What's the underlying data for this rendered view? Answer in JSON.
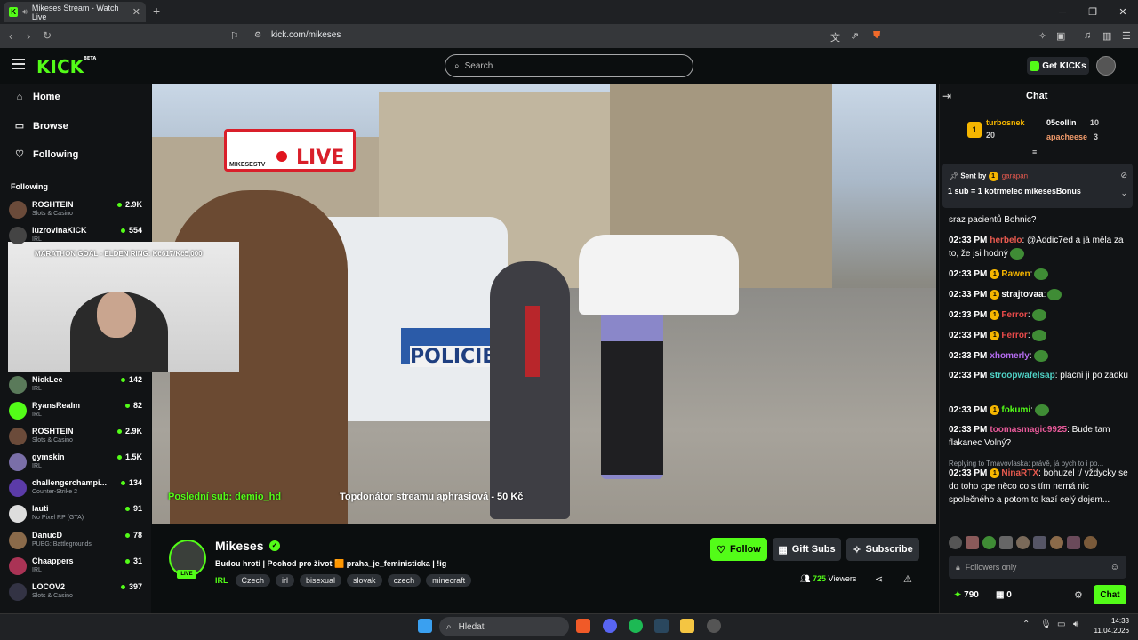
{
  "browser": {
    "tab_title": "Mikeses Stream - Watch Live",
    "url": "kick.com/mikeses",
    "tab_close": "✕",
    "new_tab": "+"
  },
  "header": {
    "logo": "KICK",
    "logo_beta": "BETA",
    "search_placeholder": "Search",
    "get_kicks": "Get KICKs"
  },
  "sidebar": {
    "nav": [
      {
        "label": "Home",
        "icon": "home-icon"
      },
      {
        "label": "Browse",
        "icon": "browse-icon"
      },
      {
        "label": "Following",
        "icon": "heart-icon"
      }
    ],
    "following_heading": "Following",
    "channels": [
      {
        "name": "ROSHTEIN",
        "category": "Slots & Casino",
        "viewers": "2.9K",
        "color": "#6b4b3a"
      },
      {
        "name": "luzrovinaKICK",
        "category": "IRL",
        "viewers": "554",
        "color": "#444"
      },
      {
        "name": "NickLee",
        "category": "IRL",
        "viewers": "142",
        "color": "#5a7a5a"
      },
      {
        "name": "RyansRealm",
        "category": "IRL",
        "viewers": "82",
        "color": "#53fc18"
      },
      {
        "name": "ROSHTEIN",
        "category": "Slots & Casino",
        "viewers": "2.9K",
        "color": "#6b4b3a"
      },
      {
        "name": "gymskin",
        "category": "IRL",
        "viewers": "1.5K",
        "color": "#7a6fa8"
      },
      {
        "name": "challengerchampi...",
        "category": "Counter-Strike 2",
        "viewers": "134",
        "color": "#5b3ba8"
      },
      {
        "name": "lauti",
        "category": "No Pixel RP (GTA)",
        "viewers": "91",
        "color": "#ddd"
      },
      {
        "name": "DanucD",
        "category": "PUBG: Battlegrounds",
        "viewers": "78",
        "color": "#8a6a4a"
      },
      {
        "name": "Chaappers",
        "category": "IRL",
        "viewers": "31",
        "color": "#aa3355"
      },
      {
        "name": "LOCOV2",
        "category": "Slots & Casino",
        "viewers": "397",
        "color": "#334"
      }
    ]
  },
  "video": {
    "marathon_goal": "MARATHON GOAL - ELDEN RING: Kč617/Kč5,000",
    "live_badge": "LIVE",
    "live_badge_brand": "MIKESESTV",
    "last_sub": "Poslední sub: demio_hd",
    "top_donor": "Topdonátor streamu aphrasiová - 50 Kč"
  },
  "channel": {
    "name": "Mikeses",
    "live_chip": "LIVE",
    "title": "Budou hroti | Pochod pro život 🟧 praha_je_feministicka | !ig",
    "category": "IRL",
    "tags": [
      "Czech",
      "irl",
      "bisexual",
      "slovak",
      "czech",
      "minecraft"
    ],
    "follow_label": "Follow",
    "gift_subs_label": "Gift Subs",
    "subscribe_label": "Subscribe",
    "viewers_count": "725",
    "viewers_label": "Viewers"
  },
  "chat": {
    "title": "Chat",
    "leaderboard": [
      {
        "name": "turbosnek",
        "count": "20"
      },
      {
        "name": "05collin",
        "count": "10"
      },
      {
        "name": "apacheese",
        "count": "3"
      }
    ],
    "pinned": {
      "sent_by": "Sent by",
      "sender": "garapan",
      "text": "1 sub = 1 kotrmelec mikesesBonus"
    },
    "messages": [
      {
        "time": "",
        "user": "",
        "user_color": "#fff",
        "text": "sraz pacientů Bohnic?"
      },
      {
        "time": "02:33 PM",
        "user": "herbelo",
        "user_color": "#e85a4f",
        "text": ": @Addic7ed a já měla za to, že jsi hodný"
      },
      {
        "time": "02:33 PM",
        "user": "Rawen",
        "user_color": "#f6b600",
        "text": ":"
      },
      {
        "time": "02:33 PM",
        "user": "strajtovaa",
        "user_color": "#fff",
        "text": ":"
      },
      {
        "time": "02:33 PM",
        "user": "Ferror",
        "user_color": "#e84a4a",
        "text": ":"
      },
      {
        "time": "02:33 PM",
        "user": "Ferror",
        "user_color": "#e84a4a",
        "text": ":"
      },
      {
        "time": "02:33 PM",
        "user": "xhomerly",
        "user_color": "#b56cf0",
        "text": ":"
      },
      {
        "time": "02:33 PM",
        "user": "stroopwafelsap",
        "user_color": "#4fd1c5",
        "text": ": placni ji po zadku"
      },
      {
        "time": "02:33 PM",
        "user": "fokumi",
        "user_color": "#53fc18",
        "text": ":"
      },
      {
        "time": "02:33 PM",
        "user": "toomasmagic9925",
        "user_color": "#e85a9a",
        "text": ": Bude tam flakanec Volný?"
      },
      {
        "time": "02:33 PM",
        "user": "NinaRTX",
        "user_color": "#e85a4f",
        "text": ": bohuzel :/ vždycky se do toho cpe něco co s tím nemá nic společného a potom to kazí celý dojem..."
      }
    ],
    "reply_note": "Replying to Tmavovlaska: právě, já bych to i po...",
    "input_placeholder": "Followers only",
    "points": "790",
    "gifts": "0",
    "chat_button": "Chat"
  },
  "taskbar": {
    "search": "Hledat",
    "time": "14:33",
    "date": "11.04.2026"
  }
}
